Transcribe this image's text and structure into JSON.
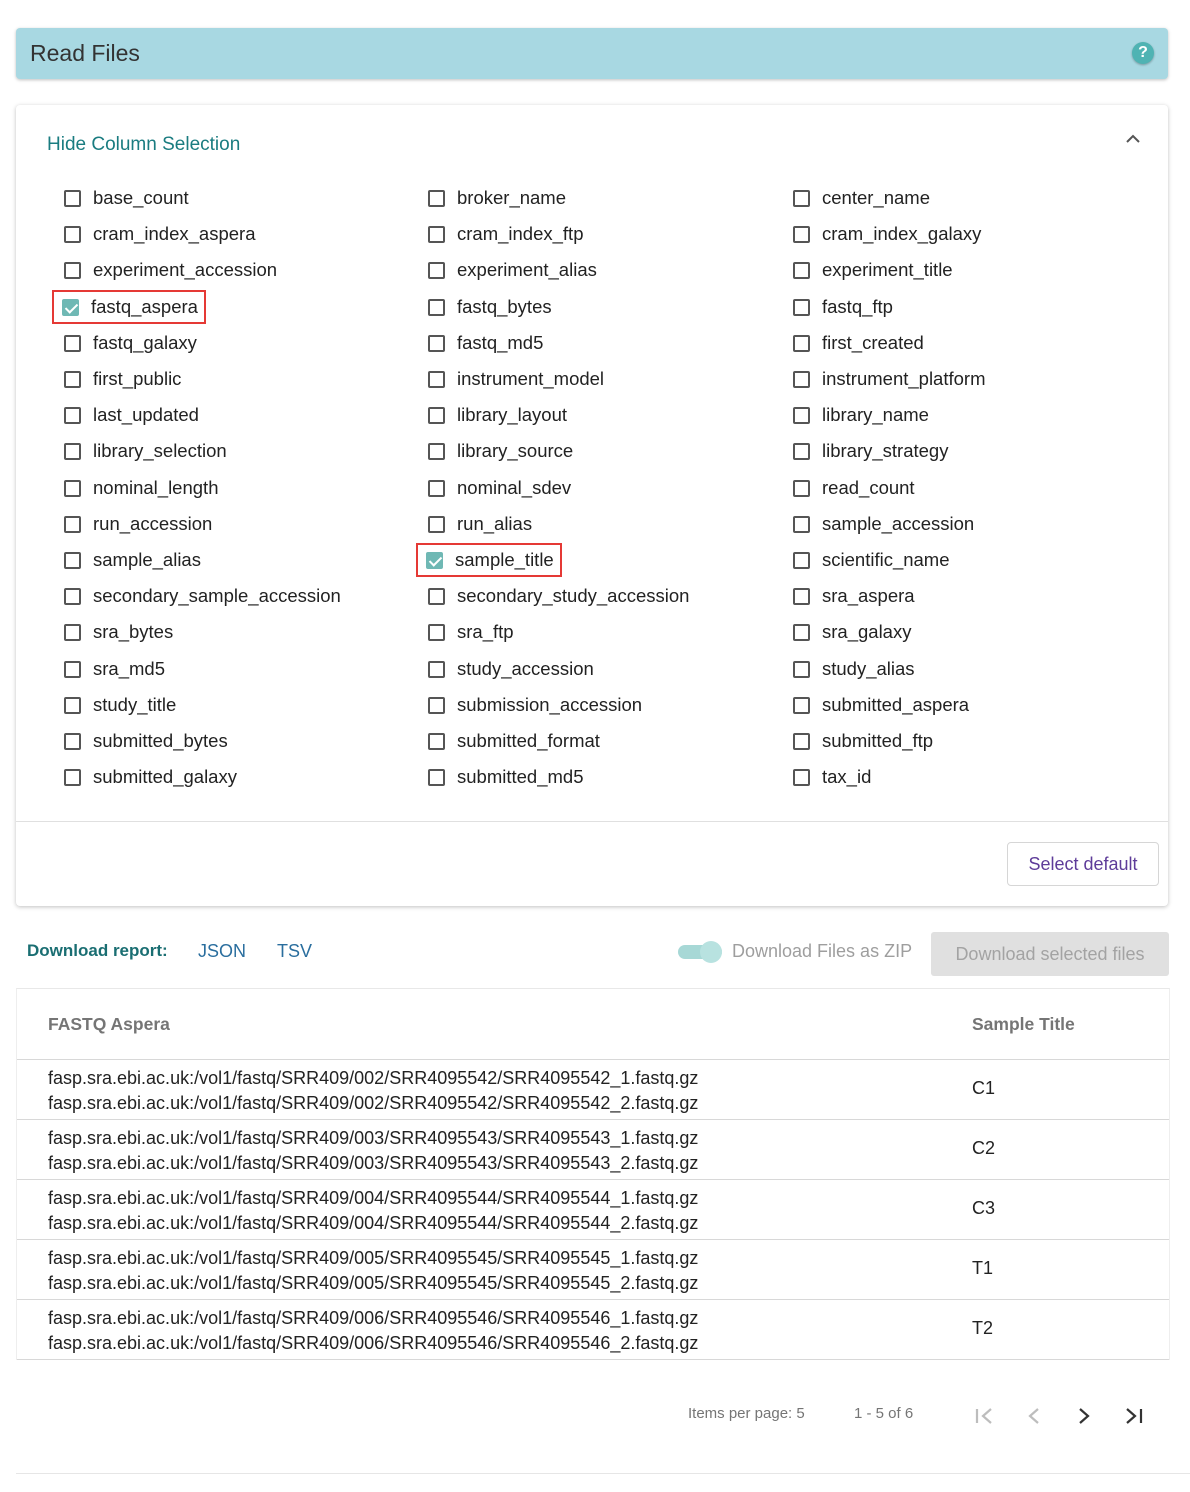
{
  "header": {
    "title": "Read Files",
    "help_icon": "?"
  },
  "column_selection": {
    "toggle_label": "Hide Column Selection",
    "columns": [
      [
        {
          "label": "base_count",
          "checked": false
        },
        {
          "label": "cram_index_aspera",
          "checked": false
        },
        {
          "label": "experiment_accession",
          "checked": false
        },
        {
          "label": "fastq_aspera",
          "checked": true
        },
        {
          "label": "fastq_galaxy",
          "checked": false
        },
        {
          "label": "first_public",
          "checked": false
        },
        {
          "label": "last_updated",
          "checked": false
        },
        {
          "label": "library_selection",
          "checked": false
        },
        {
          "label": "nominal_length",
          "checked": false
        },
        {
          "label": "run_accession",
          "checked": false
        },
        {
          "label": "sample_alias",
          "checked": false
        },
        {
          "label": "secondary_sample_accession",
          "checked": false
        },
        {
          "label": "sra_bytes",
          "checked": false
        },
        {
          "label": "sra_md5",
          "checked": false
        },
        {
          "label": "study_title",
          "checked": false
        },
        {
          "label": "submitted_bytes",
          "checked": false
        },
        {
          "label": "submitted_galaxy",
          "checked": false
        }
      ],
      [
        {
          "label": "broker_name",
          "checked": false
        },
        {
          "label": "cram_index_ftp",
          "checked": false
        },
        {
          "label": "experiment_alias",
          "checked": false
        },
        {
          "label": "fastq_bytes",
          "checked": false
        },
        {
          "label": "fastq_md5",
          "checked": false
        },
        {
          "label": "instrument_model",
          "checked": false
        },
        {
          "label": "library_layout",
          "checked": false
        },
        {
          "label": "library_source",
          "checked": false
        },
        {
          "label": "nominal_sdev",
          "checked": false
        },
        {
          "label": "run_alias",
          "checked": false
        },
        {
          "label": "sample_title",
          "checked": true
        },
        {
          "label": "secondary_study_accession",
          "checked": false
        },
        {
          "label": "sra_ftp",
          "checked": false
        },
        {
          "label": "study_accession",
          "checked": false
        },
        {
          "label": "submission_accession",
          "checked": false
        },
        {
          "label": "submitted_format",
          "checked": false
        },
        {
          "label": "submitted_md5",
          "checked": false
        }
      ],
      [
        {
          "label": "center_name",
          "checked": false
        },
        {
          "label": "cram_index_galaxy",
          "checked": false
        },
        {
          "label": "experiment_title",
          "checked": false
        },
        {
          "label": "fastq_ftp",
          "checked": false
        },
        {
          "label": "first_created",
          "checked": false
        },
        {
          "label": "instrument_platform",
          "checked": false
        },
        {
          "label": "library_name",
          "checked": false
        },
        {
          "label": "library_strategy",
          "checked": false
        },
        {
          "label": "read_count",
          "checked": false
        },
        {
          "label": "sample_accession",
          "checked": false
        },
        {
          "label": "scientific_name",
          "checked": false
        },
        {
          "label": "sra_aspera",
          "checked": false
        },
        {
          "label": "sra_galaxy",
          "checked": false
        },
        {
          "label": "study_alias",
          "checked": false
        },
        {
          "label": "submitted_aspera",
          "checked": false
        },
        {
          "label": "submitted_ftp",
          "checked": false
        },
        {
          "label": "tax_id",
          "checked": false
        }
      ]
    ],
    "select_default_label": "Select default"
  },
  "download": {
    "label": "Download report:",
    "json_link": "JSON",
    "tsv_link": "TSV",
    "zip_toggle_label": "Download Files as ZIP",
    "zip_toggle_on": true,
    "download_button_label": "Download selected files"
  },
  "table": {
    "headers": [
      "FASTQ Aspera",
      "Sample Title"
    ],
    "rows": [
      {
        "files": [
          "fasp.sra.ebi.ac.uk:/vol1/fastq/SRR409/002/SRR4095542/SRR4095542_1.fastq.gz",
          "fasp.sra.ebi.ac.uk:/vol1/fastq/SRR409/002/SRR4095542/SRR4095542_2.fastq.gz"
        ],
        "title": "C1"
      },
      {
        "files": [
          "fasp.sra.ebi.ac.uk:/vol1/fastq/SRR409/003/SRR4095543/SRR4095543_1.fastq.gz",
          "fasp.sra.ebi.ac.uk:/vol1/fastq/SRR409/003/SRR4095543/SRR4095543_2.fastq.gz"
        ],
        "title": "C2"
      },
      {
        "files": [
          "fasp.sra.ebi.ac.uk:/vol1/fastq/SRR409/004/SRR4095544/SRR4095544_1.fastq.gz",
          "fasp.sra.ebi.ac.uk:/vol1/fastq/SRR409/004/SRR4095544/SRR4095544_2.fastq.gz"
        ],
        "title": "C3"
      },
      {
        "files": [
          "fasp.sra.ebi.ac.uk:/vol1/fastq/SRR409/005/SRR4095545/SRR4095545_1.fastq.gz",
          "fasp.sra.ebi.ac.uk:/vol1/fastq/SRR409/005/SRR4095545/SRR4095545_2.fastq.gz"
        ],
        "title": "T1"
      },
      {
        "files": [
          "fasp.sra.ebi.ac.uk:/vol1/fastq/SRR409/006/SRR4095546/SRR4095546_1.fastq.gz",
          "fasp.sra.ebi.ac.uk:/vol1/fastq/SRR409/006/SRR4095546/SRR4095546_2.fastq.gz"
        ],
        "title": "T2"
      }
    ]
  },
  "paginator": {
    "items_per_page_label": "Items per page: 5",
    "range_label": "1 - 5 of 6",
    "first_page_icon": "first-page-icon",
    "prev_page_icon": "chevron-left-icon",
    "next_page_icon": "chevron-right-icon",
    "last_page_icon": "last-page-icon"
  },
  "colors": {
    "header_bg": "#a8d8e2",
    "accent_teal": "#1a7c80",
    "checkbox_checked": "#6fb8b4",
    "highlight_box": "#e53935",
    "select_default_text": "#5e3c99",
    "link_blue": "#2a6e9e"
  }
}
